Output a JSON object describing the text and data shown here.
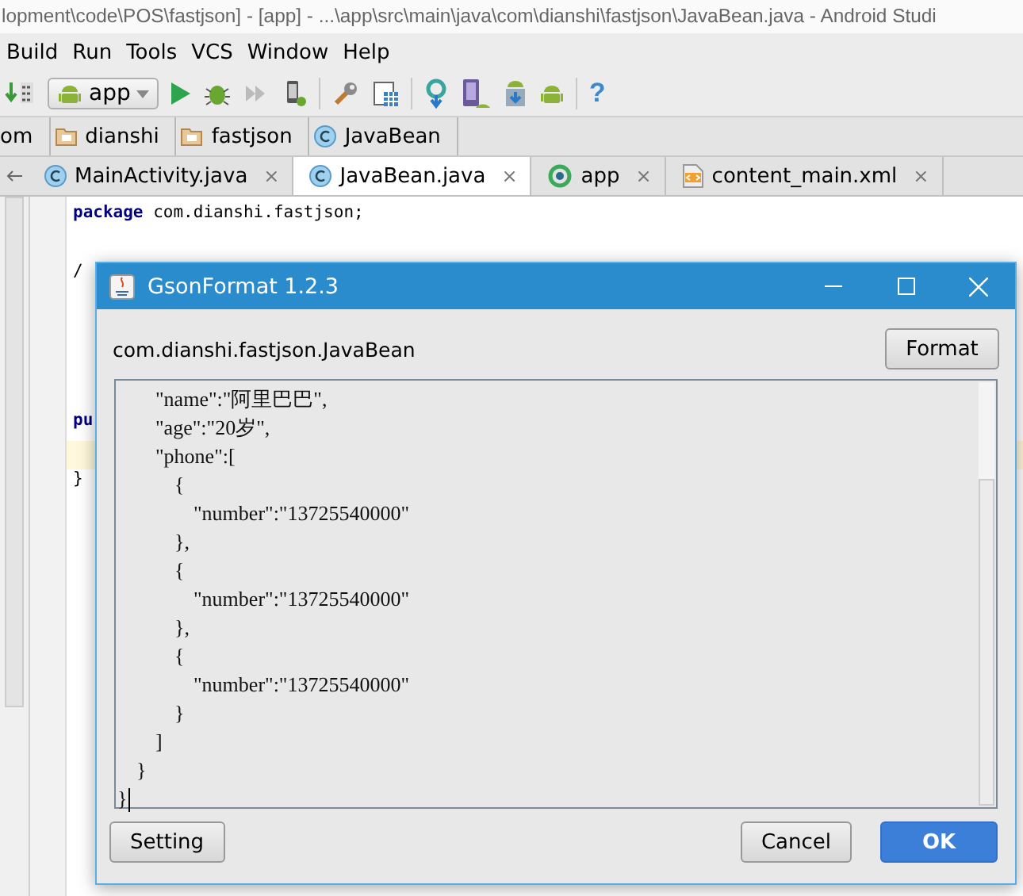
{
  "window": {
    "title": "lopment\\code\\POS\\fastjson] - [app] - ...\\app\\src\\main\\java\\com\\dianshi\\fastjson\\JavaBean.java - Android Studi"
  },
  "menu": [
    "Build",
    "Run",
    "Tools",
    "VCS",
    "Window",
    "Help"
  ],
  "toolbar": [
    {
      "kind": "make"
    },
    {
      "kind": "run_config",
      "label": "app"
    },
    {
      "kind": "run"
    },
    {
      "kind": "debug"
    },
    {
      "kind": "attach"
    },
    {
      "kind": "device"
    },
    {
      "kind": "separator"
    },
    {
      "kind": "settings"
    },
    {
      "kind": "structure"
    },
    {
      "kind": "separator"
    },
    {
      "kind": "sync"
    },
    {
      "kind": "avd"
    },
    {
      "kind": "sdk"
    },
    {
      "kind": "android"
    },
    {
      "kind": "separator"
    },
    {
      "kind": "help",
      "label": "?"
    }
  ],
  "breadcrumbs": [
    {
      "label": "om",
      "kind": "package"
    },
    {
      "label": "dianshi",
      "kind": "folder"
    },
    {
      "label": "fastjson",
      "kind": "folder"
    },
    {
      "label": "JavaBean",
      "kind": "class"
    }
  ],
  "tabs": [
    {
      "label": "MainActivity.java",
      "kind": "class",
      "selected": false,
      "close": "×"
    },
    {
      "label": "JavaBean.java",
      "kind": "class",
      "selected": true,
      "close": "×"
    },
    {
      "label": "app",
      "kind": "run_config",
      "selected": false,
      "close": "×"
    },
    {
      "label": "content_main.xml",
      "kind": "xml",
      "selected": false,
      "close": "×"
    }
  ],
  "editor": {
    "lines": [
      {
        "kind": "code",
        "text": "**package** com.dianshi.fastjson;",
        "current": false
      },
      {
        "kind": "blank",
        "current": false
      },
      {
        "kind": "code",
        "text": "/",
        "current": false
      },
      {
        "kind": "blank",
        "current": false
      },
      {
        "kind": "blank",
        "current": false
      },
      {
        "kind": "blank",
        "current": false
      },
      {
        "kind": "blank",
        "current": false
      },
      {
        "kind": "keyword",
        "text": "pu",
        "current": false
      },
      {
        "kind": "blank",
        "current": true
      },
      {
        "kind": "code",
        "text": "}",
        "current": false
      }
    ]
  },
  "dialog": {
    "title": "GsonFormat 1.2.3",
    "class_name": "com.dianshi.fastjson.JavaBean",
    "format_button": "Format",
    "json_text": "\t\t\"name\":\"阿里巴巴\",\n\t\t\"age\":\"20岁\",\n\t\t\"phone\":[\n\t\t\t{\n\t\t\t\t\"number\":\"13725540000\"\n\t\t\t},\n\t\t\t{\n\t\t\t\t\"number\":\"13725540000\"\n\t\t\t},\n\t\t\t{\n\t\t\t\t\"number\":\"13725540000\"\n\t\t\t}\n\t\t]\n\t}\n}",
    "buttons": [
      {
        "label": "Setting",
        "default": false
      },
      {
        "label": "Cancel",
        "default": false
      },
      {
        "label": "OK",
        "default": true
      }
    ]
  }
}
